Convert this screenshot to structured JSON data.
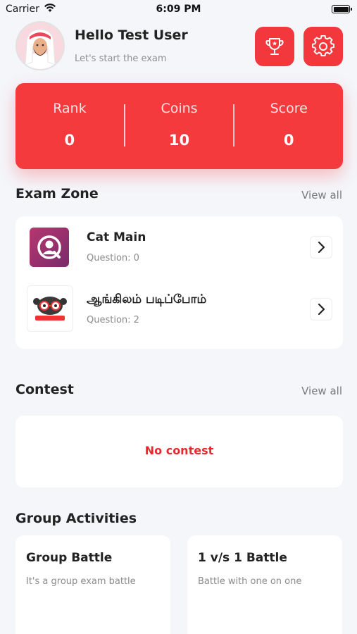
{
  "status_bar": {
    "carrier": "Carrier",
    "time": "6:09 PM"
  },
  "header": {
    "greeting": "Hello Test User",
    "subtitle": "Let's start the exam",
    "avatar": "user-avatar",
    "trophy_icon": "trophy-icon",
    "settings_icon": "gear-icon"
  },
  "stats": [
    {
      "label": "Rank",
      "value": "0"
    },
    {
      "label": "Coins",
      "value": "10"
    },
    {
      "label": "Score",
      "value": "0"
    }
  ],
  "exam_zone": {
    "title": "Exam Zone",
    "view_all": "View all",
    "items": [
      {
        "name": "Cat Main",
        "questions": "Question: 0"
      },
      {
        "name": "ஆங்கிலம் படிப்போம்",
        "questions": "Question: 2"
      }
    ]
  },
  "contest": {
    "title": "Contest",
    "view_all": "View all",
    "empty_text": "No contest"
  },
  "group_activities": {
    "title": "Group Activities",
    "cards": [
      {
        "title": "Group Battle",
        "desc": "It's a group exam battle"
      },
      {
        "title": "1 v/s 1 Battle",
        "desc": "Battle with one on one"
      }
    ]
  },
  "colors": {
    "accent": "#f53a3e",
    "background": "#f4f6fa",
    "no_contest": "#e9272c"
  }
}
